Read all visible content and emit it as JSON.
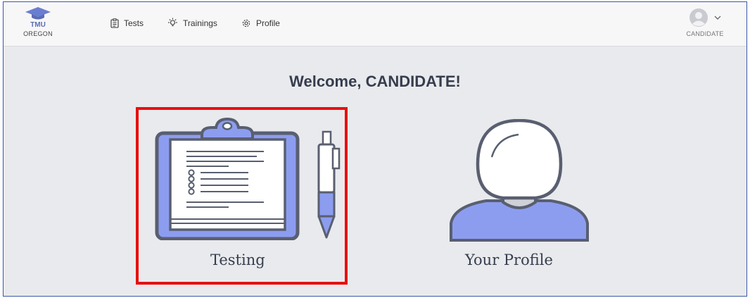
{
  "brand": {
    "line1": "TMU",
    "line2": "OREGON"
  },
  "nav": [
    {
      "label": "Tests",
      "icon": "clipboard-icon"
    },
    {
      "label": "Trainings",
      "icon": "lightbulb-icon"
    },
    {
      "label": "Profile",
      "icon": "gear-icon"
    }
  ],
  "user": {
    "name": "CANDIDATE",
    "avatar": "avatar-icon",
    "menu_icon": "chevron-down-icon"
  },
  "main": {
    "welcome": "Welcome, CANDIDATE!",
    "tiles": [
      {
        "label": "Testing",
        "icon": "clipboard-pen-icon",
        "highlighted": true
      },
      {
        "label": "Your Profile",
        "icon": "person-bust-icon",
        "highlighted": false
      }
    ]
  },
  "colors": {
    "accent": "#5a6db3",
    "illustration_fill": "#8c9df0",
    "outline": "#595f70",
    "highlight": "#e81010",
    "background": "#e9eaed"
  }
}
